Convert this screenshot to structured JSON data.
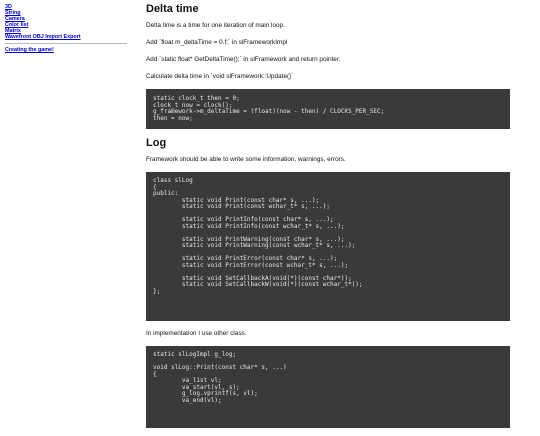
{
  "sidebar": {
    "links": [
      "3D",
      "String",
      "Camera",
      "Color list",
      "Matrix",
      "Wavefront OBJ Import Export"
    ],
    "extra_link": "Creating the game!"
  },
  "sections": {
    "delta": {
      "title": "Delta time",
      "p1": "Delta time is a time for one iteration of main loop.",
      "p2": "Add `float m_deltaTime = 0.f;` in slFrameworkImpl",
      "p3": "Add `static float* GetDeltaTime();` in slFramework and return pointer.",
      "p4": "Calculate delta time in `void slFramework::Update()`",
      "code": [
        "static clock_t then = 0;",
        "clock_t now = clock();",
        "g_framework->m_deltaTime = (float)(now - then) / CLOCKS_PER_SEC;",
        "then = now;"
      ]
    },
    "log": {
      "title": "Log",
      "p1": "Framework should be able to write some information, warnings, errors.",
      "code": [
        "class slLog",
        "{",
        "public:",
        "        static void Print(const char* s, ...);",
        "        static void Print(const wchar_t* s, ...);",
        "",
        "        static void PrintInfo(const char* s, ...);",
        "        static void PrintInfo(const wchar_t* s, ...);",
        "",
        "        static void PrintWarning(const char* s, ...);",
        "        static void PrintWarning(const wchar_t* s, ...);",
        "",
        "        static void PrintError(const char* s, ...);",
        "        static void PrintError(const wchar_t* s, ...);",
        "",
        "        static void SetCallbackA(void(*)(const char*));",
        "        static void SetCallbackW(void(*)(const wchar_t*));",
        "};"
      ],
      "p2": "In implementation I use other class.",
      "code2": [
        "static slLogImpl g_log;",
        "",
        "void slLog::Print(const char* s, ...)",
        "{",
        "        va_list vl;",
        "        va_start(vl, s);",
        "        g_log.vprintf(s, vl);",
        "        va_end(vl);"
      ]
    }
  }
}
